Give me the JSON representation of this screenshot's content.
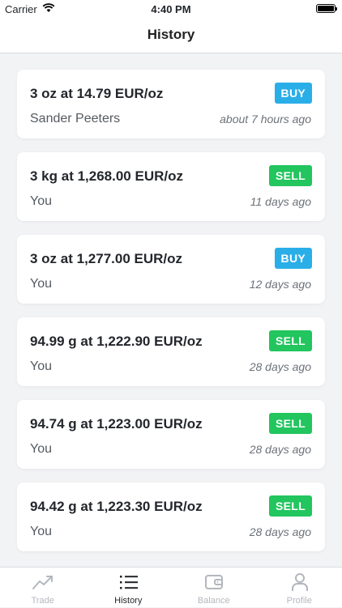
{
  "status": {
    "carrier": "Carrier",
    "time": "4:40 PM"
  },
  "nav": {
    "title": "History"
  },
  "colors": {
    "buy": "#2aaee8",
    "sell": "#22c55e",
    "active_tab": "#1f2328",
    "inactive_tab": "#b3b7bd"
  },
  "history": [
    {
      "amount": "3 oz at 14.79 EUR/oz",
      "side": "BUY",
      "party": "Sander Peeters",
      "when": "about 7 hours ago"
    },
    {
      "amount": "3 kg at 1,268.00 EUR/oz",
      "side": "SELL",
      "party": "You",
      "when": "11 days ago"
    },
    {
      "amount": "3 oz at 1,277.00 EUR/oz",
      "side": "BUY",
      "party": "You",
      "when": "12 days ago"
    },
    {
      "amount": "94.99 g at 1,222.90 EUR/oz",
      "side": "SELL",
      "party": "You",
      "when": "28 days ago"
    },
    {
      "amount": "94.74 g at 1,223.00 EUR/oz",
      "side": "SELL",
      "party": "You",
      "when": "28 days ago"
    },
    {
      "amount": "94.42 g at 1,223.30 EUR/oz",
      "side": "SELL",
      "party": "You",
      "when": "28 days ago"
    }
  ],
  "tabs": [
    {
      "label": "Trade",
      "icon": "trend-up-icon"
    },
    {
      "label": "History",
      "icon": "list-icon"
    },
    {
      "label": "Balance",
      "icon": "wallet-icon"
    },
    {
      "label": "Profile",
      "icon": "person-icon"
    }
  ]
}
